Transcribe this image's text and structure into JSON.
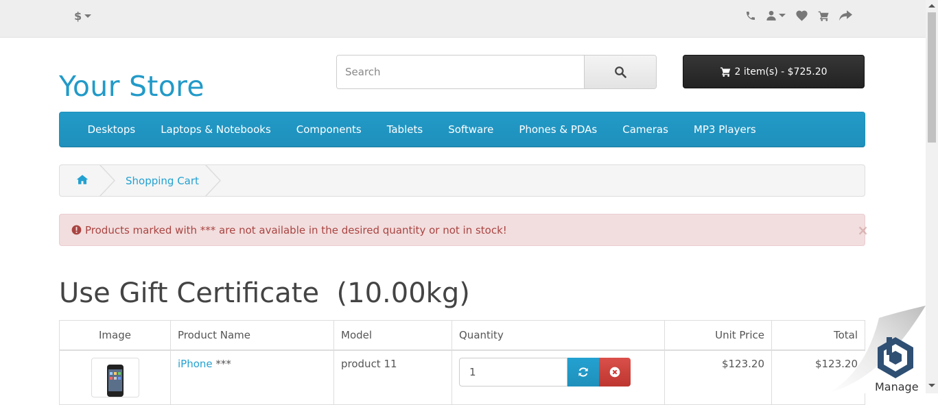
{
  "topbar": {
    "currency": "$",
    "icons": [
      "phone-icon",
      "user-icon",
      "heart-icon",
      "cart-icon",
      "share-icon"
    ]
  },
  "header": {
    "logo": "Your Store",
    "search_placeholder": "Search",
    "cart_label": "2 item(s) - $725.20"
  },
  "menu": [
    "Desktops",
    "Laptops & Notebooks",
    "Components",
    "Tablets",
    "Software",
    "Phones & PDAs",
    "Cameras",
    "MP3 Players"
  ],
  "breadcrumb": {
    "current": "Shopping Cart"
  },
  "alert": {
    "text": "Products marked with *** are not available in the desired quantity or not in stock!",
    "close": "×"
  },
  "page": {
    "title": "Use Gift Certificate  (10.00kg)"
  },
  "table": {
    "headers": [
      "Image",
      "Product Name",
      "Model",
      "Quantity",
      "Unit Price",
      "Total"
    ],
    "rows": [
      {
        "name": "iPhone",
        "mark": " ***",
        "model": "product 11",
        "quantity": "1",
        "unit_price": "$123.20",
        "total": "$123.20"
      }
    ]
  },
  "widget": {
    "label": "Manage"
  },
  "colors": {
    "brand": "#229ac8",
    "alert_bg": "#f2dede",
    "alert_text": "#a94442",
    "cart_button": "#222222",
    "remove_button": "#da4f49"
  }
}
